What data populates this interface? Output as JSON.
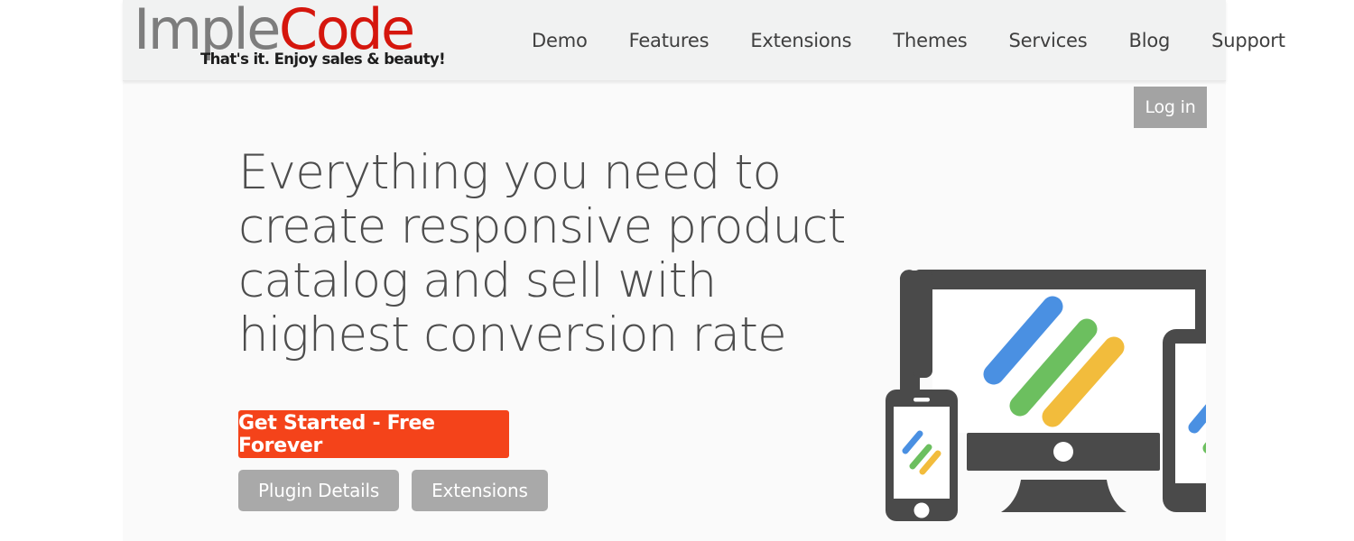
{
  "header": {
    "logo": {
      "part_gray": "Imple",
      "part_red": "Code",
      "tagline": "That's it. Enjoy sales & beauty!",
      "color_gray": "#7d7d7d",
      "color_red": "#d5160d"
    },
    "nav": [
      {
        "label": "Demo"
      },
      {
        "label": "Features"
      },
      {
        "label": "Extensions"
      },
      {
        "label": "Themes"
      },
      {
        "label": "Services"
      },
      {
        "label": "Blog"
      },
      {
        "label": "Support"
      }
    ],
    "login_label": "Log in",
    "login_bg": "#a3a3a3",
    "bar_bg": "#f1f2f2"
  },
  "hero": {
    "headline": "Everything you need to create responsive product catalog and sell with highest conversion rate",
    "headline_color": "#4d4d4d",
    "cta": {
      "label": "Get Started - Free Forever",
      "bg": "#f4431a",
      "text_color": "#ffffff"
    },
    "secondary_buttons": [
      {
        "label": "Plugin Details",
        "bg": "#a9a9a9"
      },
      {
        "label": "Extensions",
        "bg": "#a9a9a9"
      }
    ]
  },
  "illustration": {
    "name": "responsive-devices-illustration",
    "device_color": "#4a4a4a",
    "screen_color": "#ffffff",
    "stripes": [
      {
        "name": "blue-stripe",
        "color": "#4a90e2"
      },
      {
        "name": "green-stripe",
        "color": "#6cbf5f"
      },
      {
        "name": "yellow-stripe",
        "color": "#f2bc3c"
      }
    ],
    "devices": [
      {
        "name": "smartphone"
      },
      {
        "name": "desktop-monitor"
      },
      {
        "name": "tablet"
      }
    ]
  },
  "page": {
    "body_bg": "#fafafa",
    "outer_bg": "#ffffff"
  }
}
